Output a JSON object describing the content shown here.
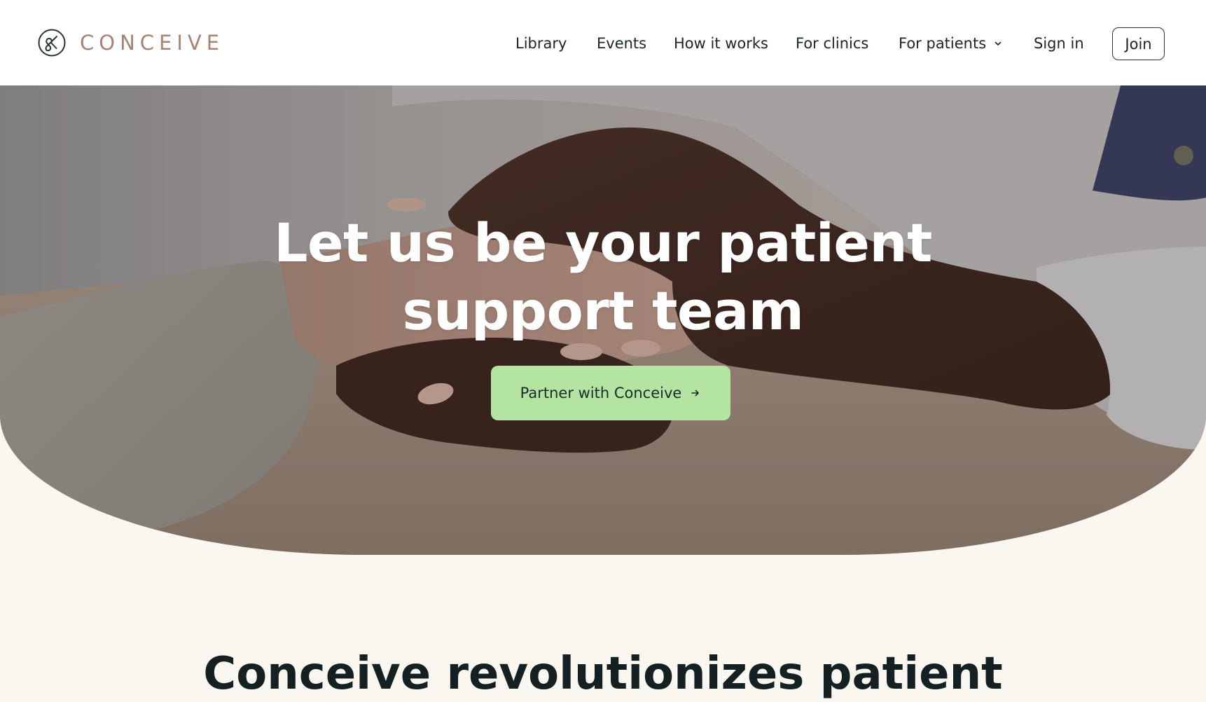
{
  "brand": {
    "name": "CONCEIVE",
    "logo_icon": "conceive-logo-mark",
    "text_color": "#a98274",
    "mark_color": "#2a3436"
  },
  "nav": {
    "items": [
      {
        "label": "Library"
      },
      {
        "label": "Events"
      },
      {
        "label": "How it works"
      },
      {
        "label": "For clinics"
      },
      {
        "label": "For patients",
        "icon": "chevron-down-icon"
      }
    ],
    "sign_in": "Sign in",
    "join": "Join"
  },
  "hero": {
    "title_line1": "Let us be your patient",
    "title_line2": "support team",
    "cta_label": "Partner with Conceive",
    "cta_icon": "arrow-right-icon",
    "cta_color": "#b4e4a2",
    "image": "hands-holding-photo"
  },
  "intro": {
    "heading": "Conceive revolutionizes patient",
    "background": "#faf7f1"
  }
}
